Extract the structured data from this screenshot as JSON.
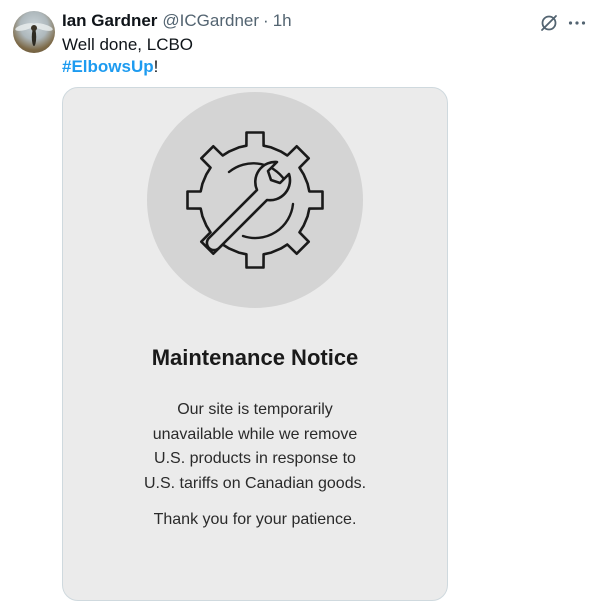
{
  "post": {
    "author_name": "Ian Gardner",
    "author_handle": "@ICGardner",
    "separator": "·",
    "time": "1h",
    "text_line1": "Well done, LCBO",
    "hashtag": "#ElbowsUp",
    "hashtag_suffix": "!"
  },
  "actions": {
    "icons": [
      "grok-icon",
      "more-icon"
    ]
  },
  "card": {
    "title": "Maintenance Notice",
    "body_lines": [
      "Our site is temporarily",
      "unavailable while we remove",
      "U.S. products in response to",
      "U.S. tariffs on Canadian goods."
    ],
    "thanks": "Thank you for your patience.",
    "icon": "gear-wrench-icon"
  },
  "colors": {
    "link": "#1d9bf0",
    "muted": "#536471",
    "card_bg": "#ebebeb",
    "circle_bg": "#d4d4d4"
  }
}
